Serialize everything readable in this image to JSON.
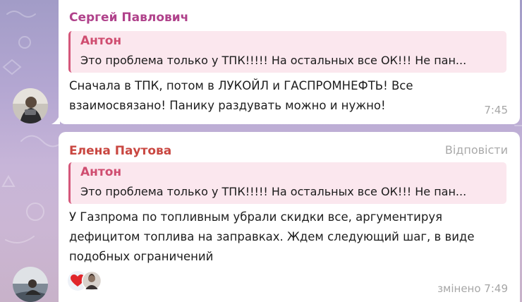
{
  "messages": [
    {
      "sender": "Сергей Павлович",
      "sender_color": "#b0428b",
      "quote_author": "Антон",
      "quote_text": "Это проблема только у ТПК!!!!! На остальных все ОК!!! Не пан...",
      "text_lines": [
        "Сначала в ТПК, потом в ЛУКОЙЛ и ГАСПРОМНЕФТЬ! Все",
        "взаимосвязано! Панику раздувать можно и нужно!"
      ],
      "time": "7:45"
    },
    {
      "sender": "Елена Паутова",
      "sender_color": "#c94741",
      "reply_label": "Відповісти",
      "quote_author": "Антон",
      "quote_text": "Это проблема только у ТПК!!!!! На остальных все ОК!!! Не пан...",
      "text_lines": [
        "У Газпрома по топливным убрали скидки все, аргументируя",
        "дефицитом топлива на заправках. Ждем следующий шаг, в виде",
        "подобных ограничений"
      ],
      "reactions": [
        "heart-emoji",
        "user-avatar"
      ],
      "time": "змінено 7:49"
    }
  ],
  "colors": {
    "quote_accent": "#d4577a",
    "quote_bg": "#fbe7ee",
    "bubble_bg": "#ffffff",
    "heart": "#e0262b"
  }
}
